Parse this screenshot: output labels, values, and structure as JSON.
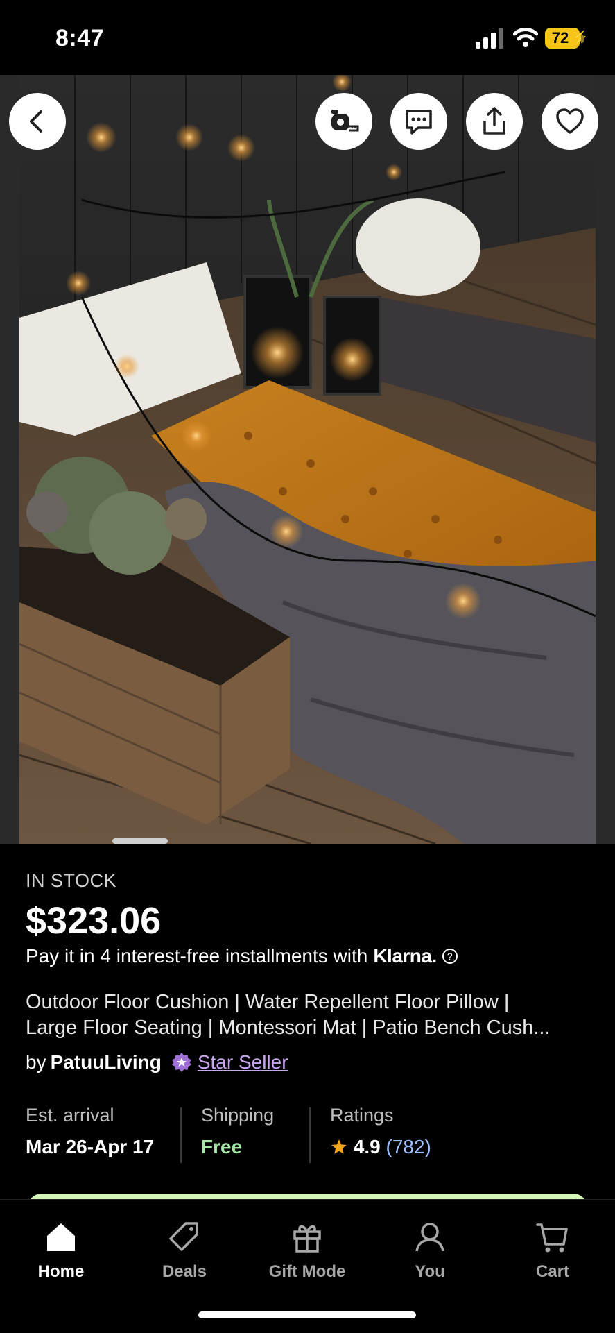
{
  "status_bar": {
    "time": "8:47",
    "battery": "72"
  },
  "product": {
    "stock": "IN STOCK",
    "price": "$323.06",
    "klarna_text": "Pay it in 4 interest-free installments with",
    "klarna_brand": "Klarna.",
    "title_line1": "Outdoor Floor Cushion | Water Repellent Floor Pillow |",
    "title_line2": "Large Floor Seating | Montessori Mat | Patio Bench Cush...",
    "by": "by",
    "shop_name": "PatuuLiving",
    "badge": "Star Seller"
  },
  "stats": {
    "arrival_label": "Est. arrival",
    "arrival_value": "Mar 26-Apr 17",
    "shipping_label": "Shipping",
    "shipping_value": "Free",
    "ratings_label": "Ratings",
    "rating_value": "4.9",
    "rating_count": "(782)"
  },
  "tabs": [
    {
      "label": "Home",
      "icon": "home-icon",
      "active": true
    },
    {
      "label": "Deals",
      "icon": "tag-icon"
    },
    {
      "label": "Gift Mode",
      "icon": "gift-icon"
    },
    {
      "label": "You",
      "icon": "person-icon"
    },
    {
      "label": "Cart",
      "icon": "cart-icon"
    }
  ],
  "colors": {
    "accent_purple": "#c9a7f0",
    "free_green": "#a6e6a6",
    "count_blue": "#9ec0ff",
    "star_gold": "#f2a51b"
  }
}
